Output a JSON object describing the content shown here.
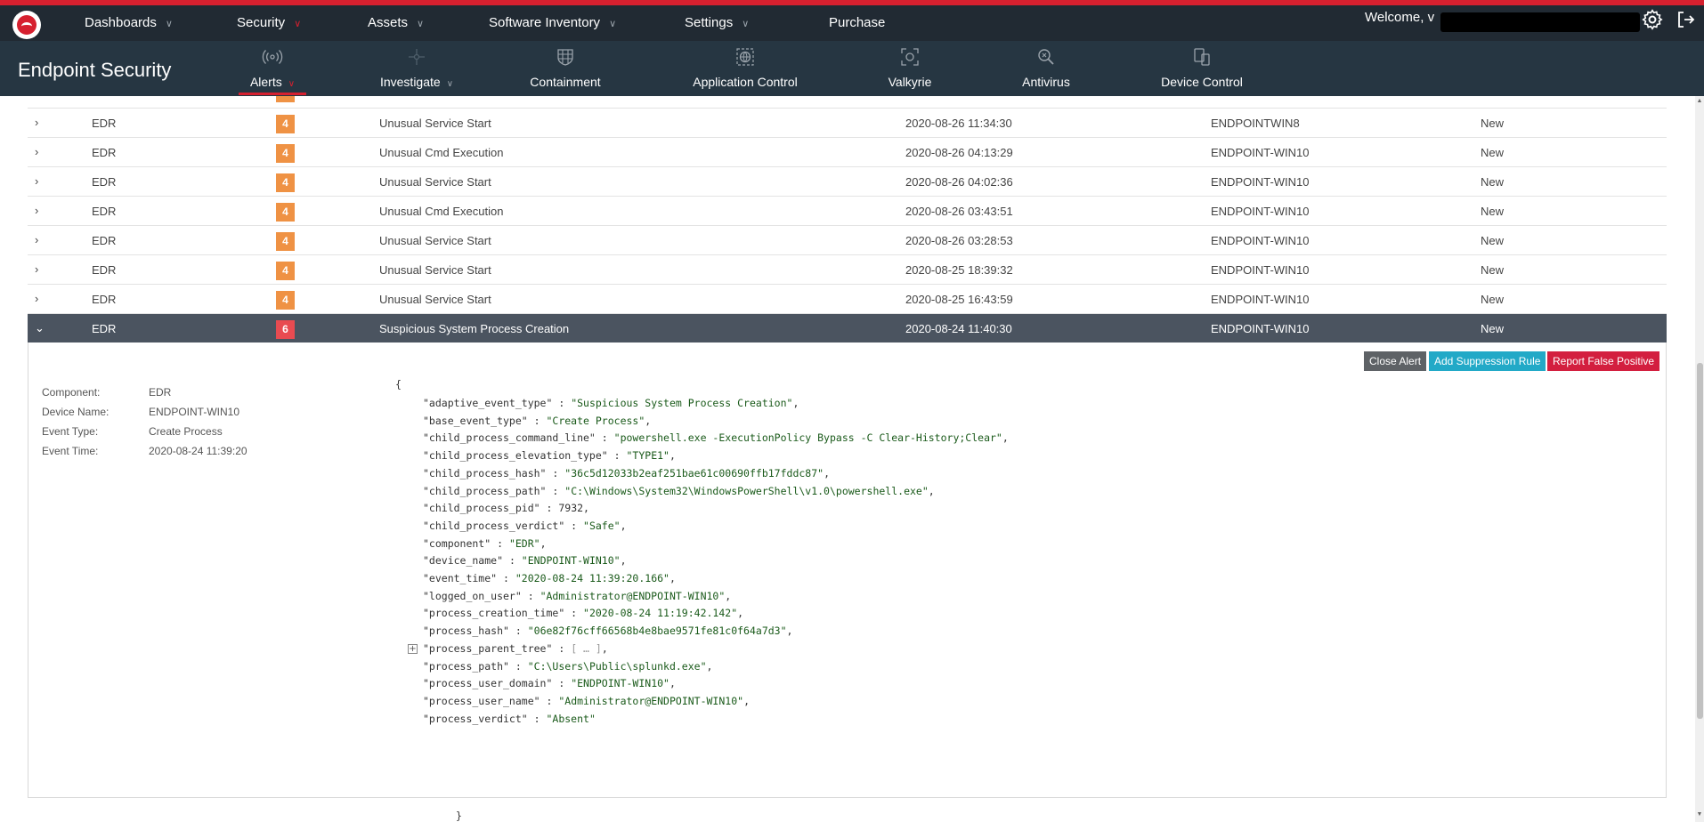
{
  "topnav": {
    "items": [
      {
        "label": "Dashboards",
        "has_chevron": true
      },
      {
        "label": "Security",
        "has_chevron": true,
        "active": true
      },
      {
        "label": "Assets",
        "has_chevron": true
      },
      {
        "label": "Software Inventory",
        "has_chevron": true
      },
      {
        "label": "Settings",
        "has_chevron": true
      },
      {
        "label": "Purchase",
        "has_chevron": false
      }
    ],
    "welcome": "Welcome, v",
    "chevron_glyph": "∨",
    "icons": [
      "logo-icon",
      "gear-icon",
      "logout-icon"
    ]
  },
  "subnav": {
    "product_title": "Endpoint Security",
    "items": [
      {
        "label": "Alerts",
        "icon": "radar-icon",
        "has_chevron": true,
        "active": true
      },
      {
        "label": "Investigate",
        "icon": "network-icon",
        "has_chevron": true
      },
      {
        "label": "Containment",
        "icon": "grid-shield-icon"
      },
      {
        "label": "Application Control",
        "icon": "globe-settings-icon"
      },
      {
        "label": "Valkyrie",
        "icon": "scan-icon"
      },
      {
        "label": "Antivirus",
        "icon": "search-bug-icon"
      },
      {
        "label": "Device Control",
        "icon": "devices-icon"
      }
    ]
  },
  "alerts": {
    "rows": [
      {
        "component": "EDR",
        "severity": "4",
        "name": "Unusual Service Start",
        "time": "2020-08-26 11:34:30",
        "device": "ENDPOINTWIN8",
        "status": "New"
      },
      {
        "component": "EDR",
        "severity": "4",
        "name": "Unusual Cmd Execution",
        "time": "2020-08-26 04:13:29",
        "device": "ENDPOINT-WIN10",
        "status": "New"
      },
      {
        "component": "EDR",
        "severity": "4",
        "name": "Unusual Service Start",
        "time": "2020-08-26 04:02:36",
        "device": "ENDPOINT-WIN10",
        "status": "New"
      },
      {
        "component": "EDR",
        "severity": "4",
        "name": "Unusual Cmd Execution",
        "time": "2020-08-26 03:43:51",
        "device": "ENDPOINT-WIN10",
        "status": "New"
      },
      {
        "component": "EDR",
        "severity": "4",
        "name": "Unusual Service Start",
        "time": "2020-08-26 03:28:53",
        "device": "ENDPOINT-WIN10",
        "status": "New"
      },
      {
        "component": "EDR",
        "severity": "4",
        "name": "Unusual Service Start",
        "time": "2020-08-25 18:39:32",
        "device": "ENDPOINT-WIN10",
        "status": "New"
      },
      {
        "component": "EDR",
        "severity": "4",
        "name": "Unusual Service Start",
        "time": "2020-08-25 16:43:59",
        "device": "ENDPOINT-WIN10",
        "status": "New"
      }
    ],
    "selected": {
      "component": "EDR",
      "severity": "6",
      "name": "Suspicious System Process Creation",
      "time": "2020-08-24 11:40:30",
      "device": "ENDPOINT-WIN10",
      "status": "New"
    },
    "severity_colors": {
      "4": "#ef9244",
      "6": "#e84b51"
    },
    "expand_glyph": "›",
    "collapse_glyph": "⌄"
  },
  "detail": {
    "buttons": {
      "close": "Close Alert",
      "suppression": "Add Suppression Rule",
      "false_positive": "Report False Positive"
    },
    "fields": [
      {
        "label": "Component:",
        "value": "EDR"
      },
      {
        "label": "Device Name:",
        "value": "ENDPOINT-WIN10"
      },
      {
        "label": "Event Type:",
        "value": "Create Process"
      },
      {
        "label": "Event Time:",
        "value": "2020-08-24 11:39:20"
      }
    ],
    "json_open": "{",
    "json_close": "}",
    "json_lines": [
      {
        "key": "\"adaptive_event_type\"",
        "value": "\"Suspicious System Process Creation\"",
        "type": "str"
      },
      {
        "key": "\"base_event_type\"",
        "value": "\"Create Process\"",
        "type": "str"
      },
      {
        "key": "\"child_process_command_line\"",
        "value": "\"powershell.exe -ExecutionPolicy Bypass -C Clear-History;Clear\"",
        "type": "str"
      },
      {
        "key": "\"child_process_elevation_type\"",
        "value": "\"TYPE1\"",
        "type": "str"
      },
      {
        "key": "\"child_process_hash\"",
        "value": "\"36c5d12033b2eaf251bae61c00690ffb17fddc87\"",
        "type": "str"
      },
      {
        "key": "\"child_process_path\"",
        "value": "\"C:\\Windows\\System32\\WindowsPowerShell\\v1.0\\powershell.exe\"",
        "type": "str"
      },
      {
        "key": "\"child_process_pid\"",
        "value": "7932",
        "type": "num"
      },
      {
        "key": "\"child_process_verdict\"",
        "value": "\"Safe\"",
        "type": "str"
      },
      {
        "key": "\"component\"",
        "value": "\"EDR\"",
        "type": "str"
      },
      {
        "key": "\"device_name\"",
        "value": "\"ENDPOINT-WIN10\"",
        "type": "str"
      },
      {
        "key": "\"event_time\"",
        "value": "\"2020-08-24 11:39:20.166\"",
        "type": "str"
      },
      {
        "key": "\"logged_on_user\"",
        "value": "\"Administrator@ENDPOINT-WIN10\"",
        "type": "str"
      },
      {
        "key": "\"process_creation_time\"",
        "value": "\"2020-08-24 11:19:42.142\"",
        "type": "str"
      },
      {
        "key": "\"process_hash\"",
        "value": "\"06e82f76cff66568b4e8bae9571fe81c0f64a7d3\"",
        "type": "str"
      },
      {
        "key": "\"process_parent_tree\"",
        "value": "[ … ]",
        "type": "fold"
      },
      {
        "key": "\"process_path\"",
        "value": "\"C:\\Users\\Public\\splunkd.exe\"",
        "type": "str"
      },
      {
        "key": "\"process_user_domain\"",
        "value": "\"ENDPOINT-WIN10\"",
        "type": "str"
      },
      {
        "key": "\"process_user_name\"",
        "value": "\"Administrator@ENDPOINT-WIN10\"",
        "type": "str"
      },
      {
        "key": "\"process_verdict\"",
        "value": "\"Absent\"",
        "type": "str"
      }
    ],
    "fold_glyph": "+"
  }
}
